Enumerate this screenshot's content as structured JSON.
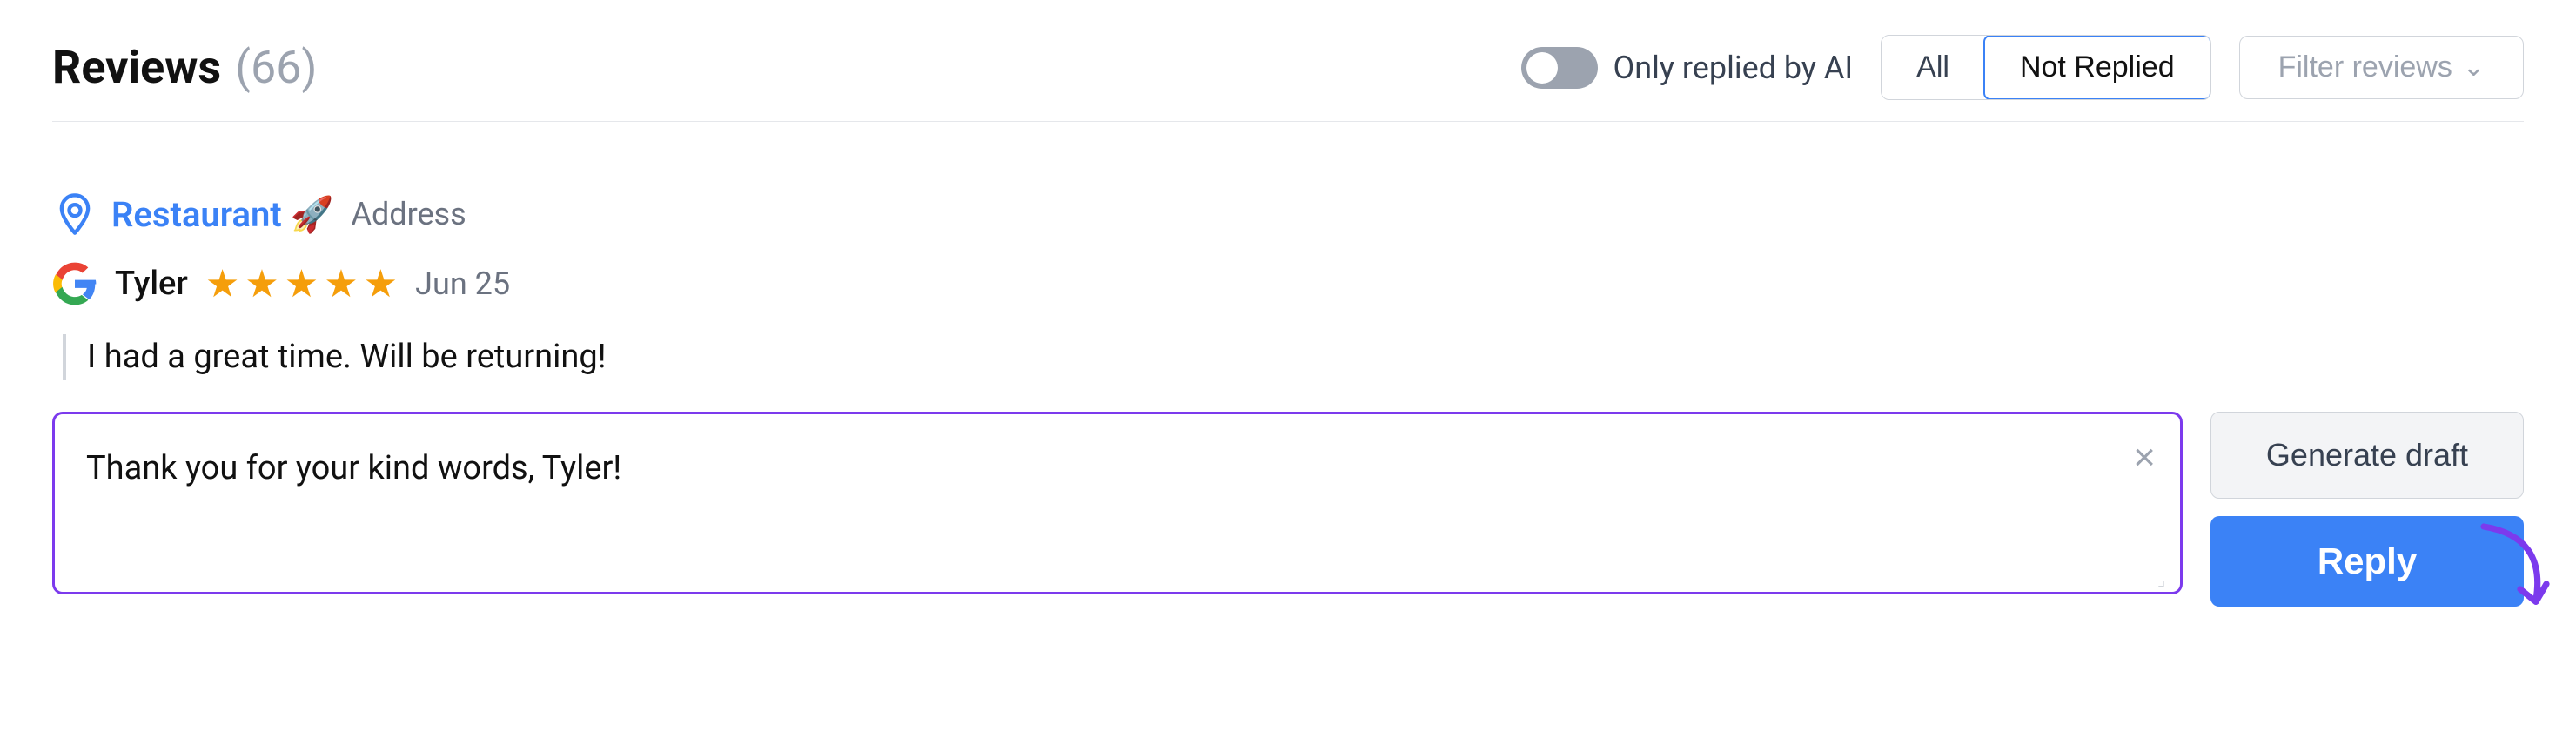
{
  "header": {
    "title": "Reviews",
    "count": "(66)",
    "toggle_label": "Only replied by AI",
    "filter_all": "All",
    "filter_not_replied": "Not Replied",
    "filter_reviews": "Filter reviews"
  },
  "review": {
    "location_name": "Restaurant 🚀",
    "location_address": "Address",
    "reviewer_name": "Tyler",
    "review_date": "Jun 25",
    "stars": 5,
    "review_text": "I had a great time. Will be returning!",
    "reply_placeholder": "Thank you for your kind words, Tyler!",
    "reply_value": "Thank you for your kind words, Tyler!"
  },
  "actions": {
    "generate_draft": "Generate draft",
    "reply": "Reply",
    "clear_icon": "×"
  }
}
